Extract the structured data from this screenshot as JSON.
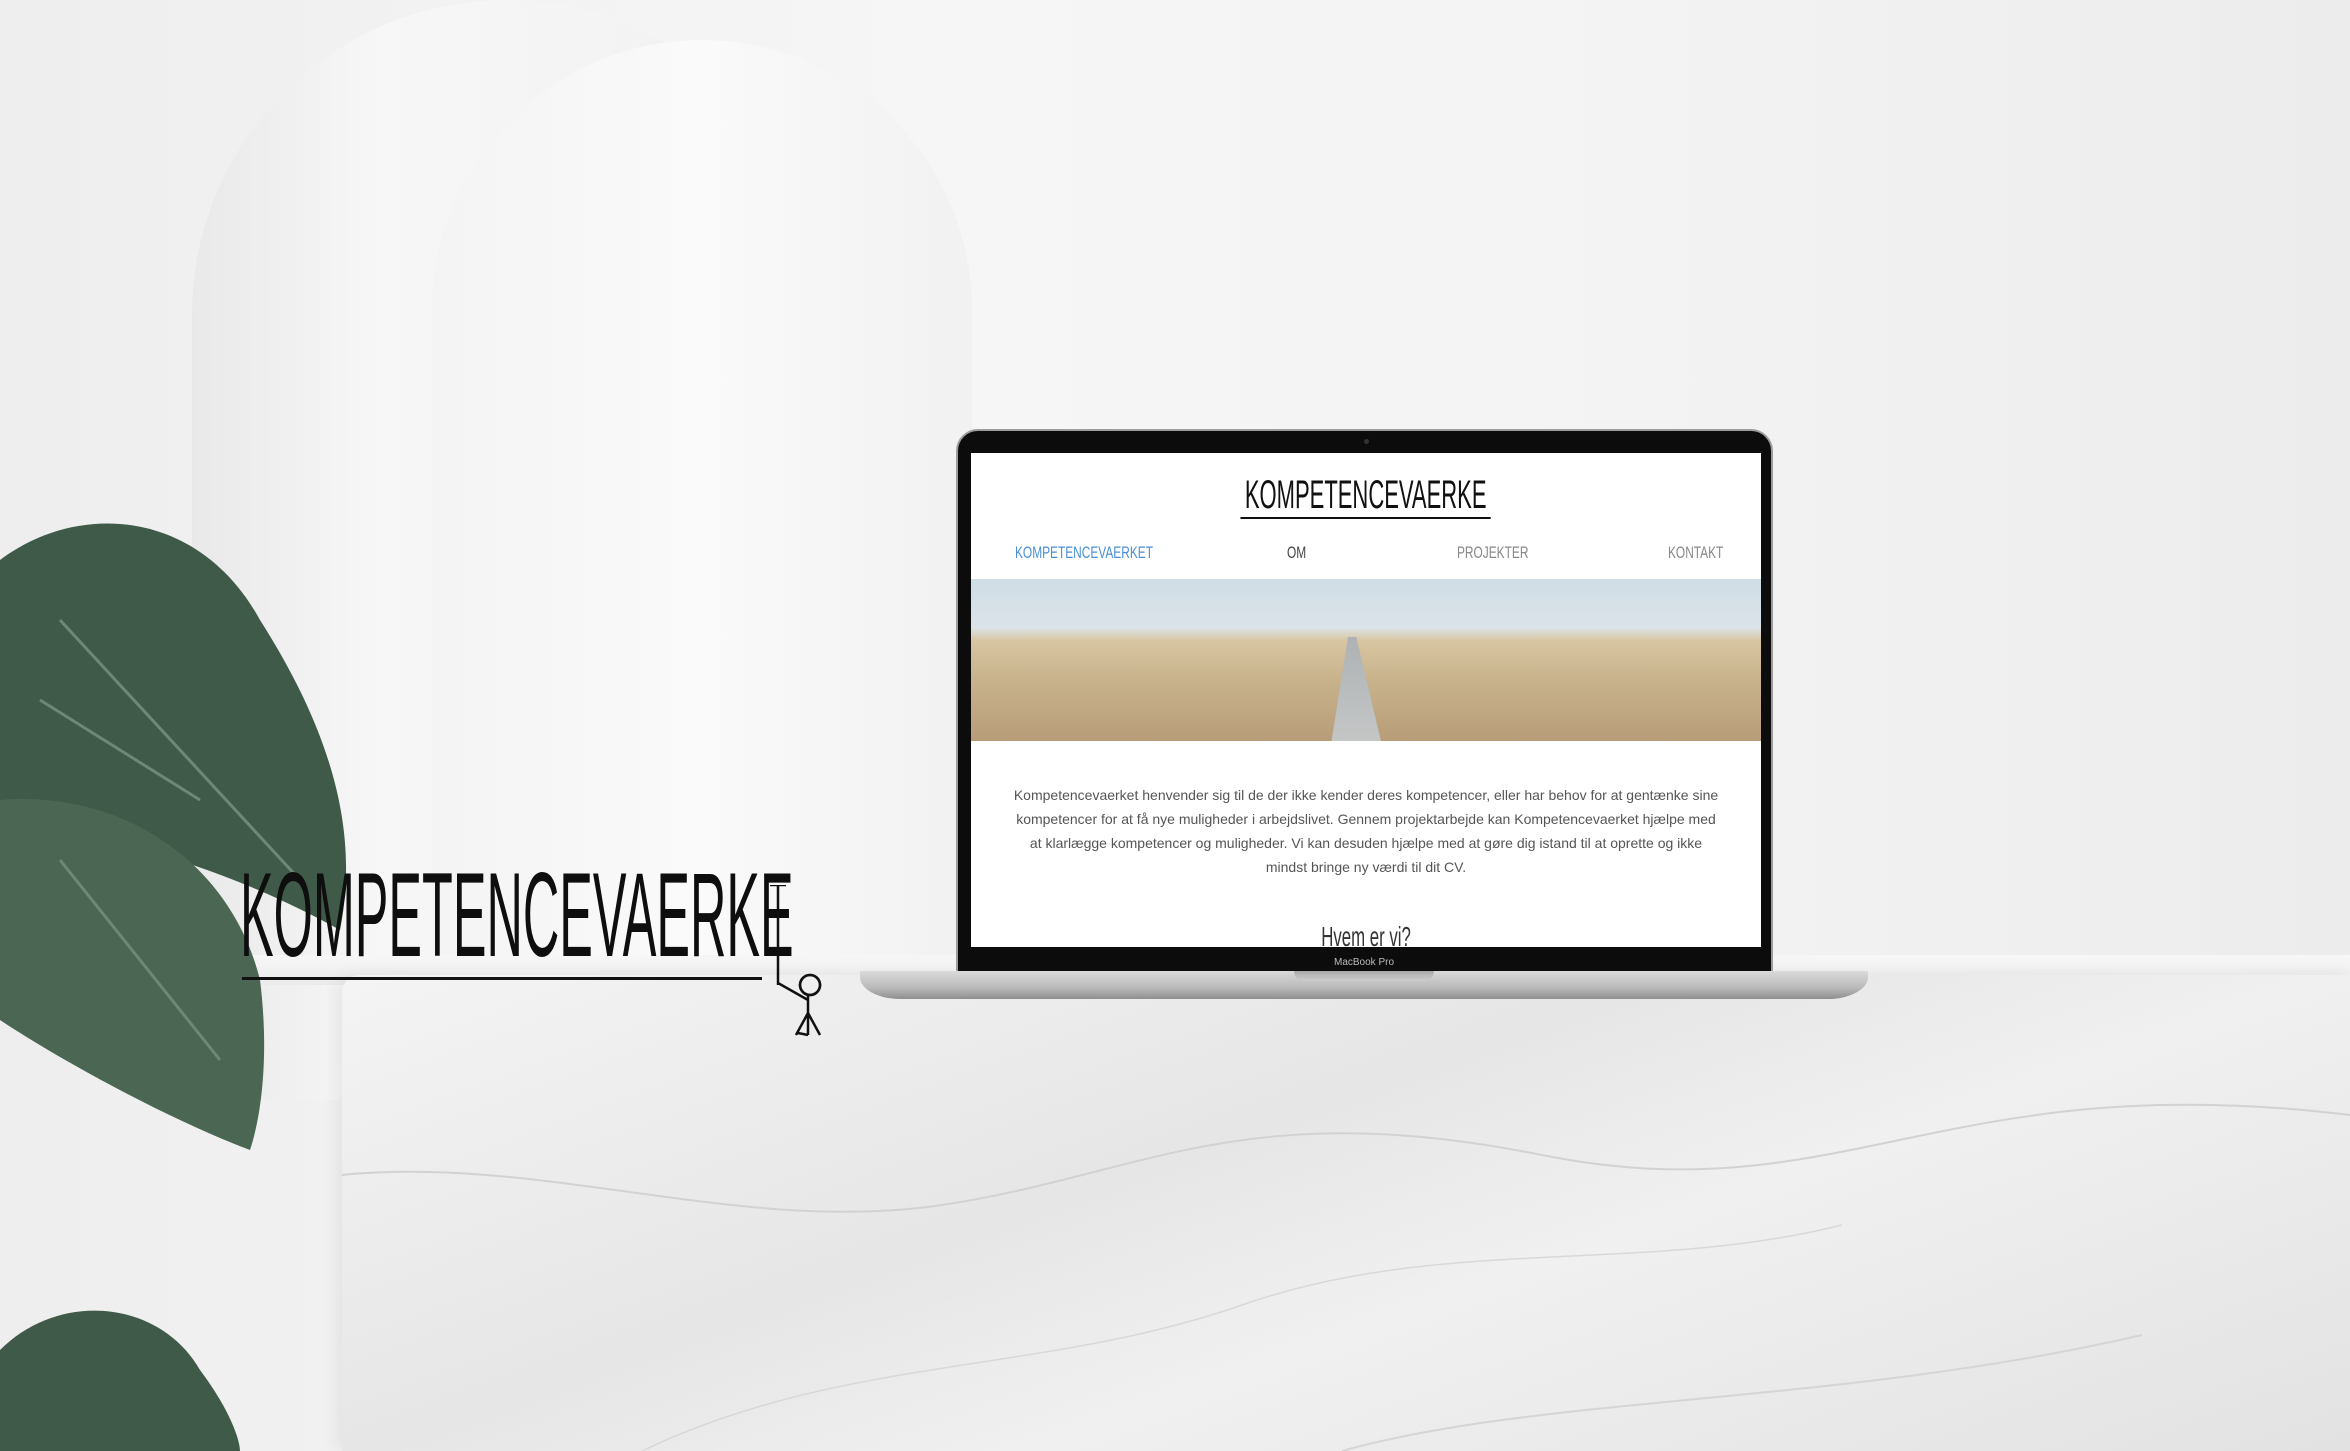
{
  "brand_logo": "KOMPETENCEVAERKE",
  "laptop": {
    "model_label": "MacBook Pro"
  },
  "website": {
    "logo": "KOMPETENCEVAERKE",
    "nav": [
      {
        "label": "KOMPETENCEVAERKET",
        "active": true
      },
      {
        "label": "OM"
      },
      {
        "label": "PROJEKTER"
      },
      {
        "label": "KONTAKT"
      }
    ],
    "intro": "Kompetencevaerket henvender sig til de der ikke kender deres kompetencer, eller har behov for at gentænke sine kompetencer for at få nye muligheder i arbejdslivet. Gennem projektarbejde kan Kompetencevaerket hjælpe med at klarlægge kompetencer og muligheder. Vi kan desuden hjælpe med at gøre dig istand til at oprette og ikke mindst bringe ny værdi til dit CV.",
    "section_heading": "Hvem er vi?"
  },
  "colors": {
    "nav_active": "#4a8fd6",
    "nav": "#8a8a8a",
    "plant": "#3f5a48"
  }
}
